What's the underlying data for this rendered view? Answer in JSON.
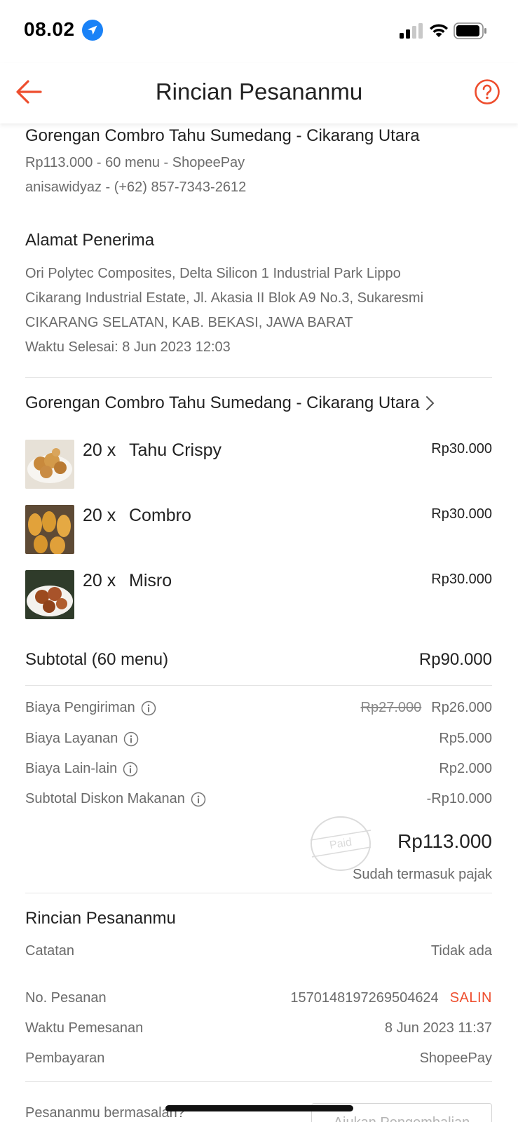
{
  "status_bar": {
    "time": "08.02"
  },
  "nav": {
    "title": "Rincian Pesananmu"
  },
  "order_summary": {
    "restaurant": "Gorengan Combro Tahu Sumedang - Cikarang Utara",
    "summary_line": "Rp113.000 - 60 menu  - ShopeePay",
    "customer_line": "anisawidyaz - (+62) 857-7343-2612"
  },
  "address": {
    "heading": "Alamat Penerima",
    "line1": "Ori Polytec Composites, Delta Silicon 1 Industrial Park Lippo",
    "line2": "Cikarang Industrial Estate, Jl. Akasia II Blok A9 No.3, Sukaresmi",
    "line3": "CIKARANG SELATAN, KAB. BEKASI, JAWA BARAT",
    "completed": "Waktu Selesai: 8 Jun 2023 12:03"
  },
  "restaurant_link": {
    "label": "Gorengan Combro Tahu Sumedang - Cikarang Utara"
  },
  "items": [
    {
      "qty": "20 x",
      "name": "Tahu Crispy",
      "price": "Rp30.000"
    },
    {
      "qty": "20 x",
      "name": "Combro",
      "price": "Rp30.000"
    },
    {
      "qty": "20 x",
      "name": "Misro",
      "price": "Rp30.000"
    }
  ],
  "subtotal": {
    "label": "Subtotal (60 menu)",
    "value": "Rp90.000"
  },
  "fees": {
    "shipping_label": "Biaya Pengiriman",
    "shipping_original": "Rp27.000",
    "shipping_value": "Rp26.000",
    "service_label": "Biaya Layanan",
    "service_value": "Rp5.000",
    "other_label": "Biaya Lain-lain",
    "other_value": "Rp2.000",
    "discount_label": "Subtotal Diskon Makanan",
    "discount_value": "-Rp10.000"
  },
  "total": {
    "value": "Rp113.000",
    "tax_note": "Sudah termasuk pajak",
    "stamp": "Paid"
  },
  "details": {
    "heading": "Rincian Pesananmu",
    "notes_label": "Catatan",
    "notes_value": "Tidak ada",
    "order_no_label": "No. Pesanan",
    "order_no_value": "1570148197269504624",
    "copy_label": "SALIN",
    "order_time_label": "Waktu Pemesanan",
    "order_time_value": "8 Jun 2023 11:37",
    "payment_label": "Pembayaran",
    "payment_value": "ShopeePay"
  },
  "footer": {
    "problem_text": "Pesananmu bermasalah?",
    "refund_button": "Ajukan Pengembalian"
  },
  "colors": {
    "accent": "#ee4d2d",
    "text_primary": "#222222",
    "text_secondary": "#6b6b6b",
    "location_blue": "#1a82f7"
  }
}
